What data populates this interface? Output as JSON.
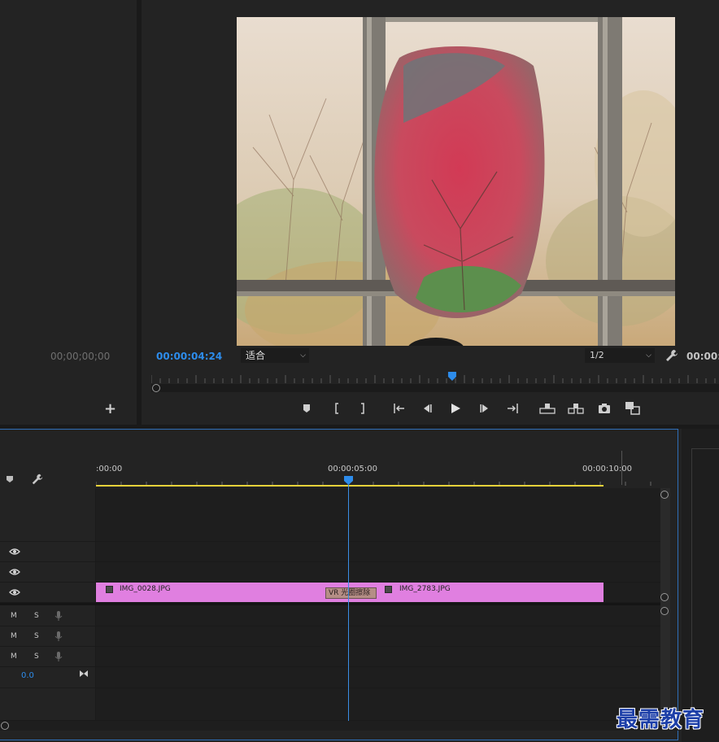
{
  "source_monitor": {
    "timecode": "00;00;00;00",
    "add_label": "+"
  },
  "program_monitor": {
    "timecode": "00:00:04:24",
    "fit": "适合",
    "resolution": "1/2",
    "duration": "00:00:",
    "playhead_fraction": 0.53
  },
  "timeline": {
    "ruler_labels": [
      ":00:00",
      "00:00:05:00",
      "00:00:10:00"
    ],
    "clip": {
      "first_name": "IMG_0028.JPG",
      "second_name": "IMG_2783.JPG",
      "transition": "VR 光圈擦除"
    },
    "audio_tracks": [
      {
        "mute": "M",
        "solo": "S"
      },
      {
        "mute": "M",
        "solo": "S"
      },
      {
        "mute": "M",
        "solo": "S"
      }
    ],
    "master_level": "0.0"
  },
  "watermark": "最需教育",
  "colors": {
    "accent_blue": "#2d8ceb",
    "clip_pink": "#e07fe0",
    "work_area_yellow": "#e6d23a"
  }
}
